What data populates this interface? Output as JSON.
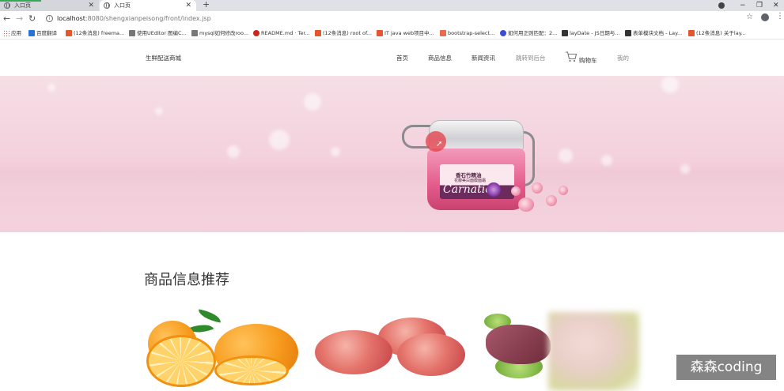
{
  "browser": {
    "tabs": [
      {
        "title": "入口页",
        "active": false
      },
      {
        "title": "入口页",
        "active": true
      }
    ],
    "new_tab": "+",
    "window_controls": {
      "minimize": "−",
      "restore": "❐",
      "close": "✕"
    },
    "url_host": "localhost",
    "url_path": ":8080/shengxianpeisong/front/index.jsp",
    "bookmarks": [
      "应用",
      "百度翻译",
      "(12条消息) freema...",
      "使用UEditor 图编C...",
      "mysql如何修改roo...",
      "README.md · Ter...",
      "(12条消息) root of...",
      "IT java web项目中...",
      "bootstrap-select...",
      "如何用正则匹配：2...",
      "layDate - JS日期与...",
      "表单模块文档 - Lay...",
      "(12条消息) 关于lay..."
    ]
  },
  "site": {
    "logo": "生鲜配送商城",
    "nav": [
      "首页",
      "商品信息",
      "新闻资讯",
      "跳转到后台",
      "购物车",
      "我的"
    ],
    "section_title": "商品信息推荐"
  },
  "banner": {
    "jar_title": "香石竹精油",
    "jar_subtitle": "花瓣美白面膜面霜",
    "jar_brand": "Carnation"
  },
  "watermark": "森森coding",
  "colors": {
    "tab_active": "#ffffff",
    "tab_inactive": "#d3d7dc",
    "accent_green": "#34a853",
    "banner_pink": "#f3d0dc"
  }
}
